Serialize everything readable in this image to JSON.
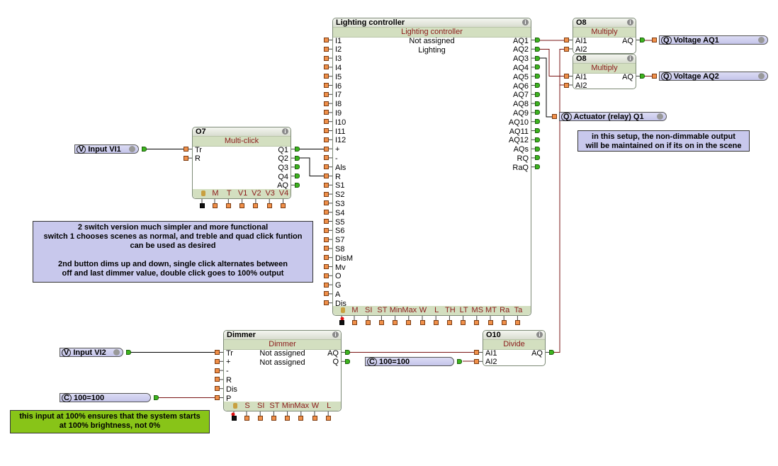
{
  "colors": {
    "analog_wire": "#7a1414",
    "digital_wire": "#000000",
    "note_blue": "#c8c8ec",
    "note_green": "#88c418"
  },
  "blocks": [
    {
      "id": "lighting",
      "title": "Lighting controller",
      "subtitle": "Lighting controller",
      "lines": [
        "Not assigned",
        "Lighting"
      ],
      "inputs": [
        "I1",
        "I2",
        "I3",
        "I4",
        "I5",
        "I6",
        "I7",
        "I8",
        "I9",
        "I10",
        "I11",
        "I12",
        "+",
        "-",
        "Als",
        "R",
        "S1",
        "S2",
        "S3",
        "S4",
        "S5",
        "S6",
        "S7",
        "S8",
        "DisM",
        "Mv",
        "O",
        "G",
        "A",
        "Dis"
      ],
      "outputs": [
        "AQ1",
        "AQ2",
        "AQ3",
        "AQ4",
        "AQ5",
        "AQ6",
        "AQ7",
        "AQ8",
        "AQ9",
        "AQ10",
        "AQ11",
        "AQ12",
        "AQs",
        "RQ",
        "RaQ"
      ],
      "params": [
        "M",
        "SI",
        "ST",
        "Min",
        "Max",
        "W",
        "L",
        "TH",
        "LT",
        "MS",
        "MT",
        "Ra",
        "Ta"
      ]
    },
    {
      "id": "multiclick",
      "title": "O7",
      "subtitle": "Multi-click",
      "lines": [],
      "inputs": [
        "Tr",
        "R"
      ],
      "outputs": [
        "Q1",
        "Q2",
        "Q3",
        "Q4",
        "AQ"
      ],
      "params": [
        "M",
        "T",
        "V1",
        "V2",
        "V3",
        "V4"
      ]
    },
    {
      "id": "multiply1",
      "title": "O8",
      "subtitle": "Multiply",
      "lines": [],
      "inputs": [
        "AI1",
        "AI2"
      ],
      "outputs": [
        "AQ"
      ],
      "params": []
    },
    {
      "id": "multiply2",
      "title": "O8",
      "subtitle": "Multiply",
      "lines": [],
      "inputs": [
        "AI1",
        "AI2"
      ],
      "outputs": [
        "AQ"
      ],
      "params": []
    },
    {
      "id": "dimmer",
      "title": "Dimmer",
      "subtitle": "Dimmer",
      "lines": [
        "Not assigned",
        "Not assigned"
      ],
      "inputs": [
        "Tr",
        "+",
        "-",
        "R",
        "Dis",
        "P"
      ],
      "outputs": [
        "AQ",
        "Q"
      ],
      "params": [
        "S",
        "SI",
        "ST",
        "Min",
        "Max",
        "W",
        "L"
      ]
    },
    {
      "id": "divide",
      "title": "O10",
      "subtitle": "Divide",
      "lines": [],
      "inputs": [
        "AI1",
        "AI2"
      ],
      "outputs": [
        "AQ"
      ],
      "params": []
    }
  ],
  "terminals": [
    {
      "tag": "Q",
      "label": "Voltage AQ1",
      "info": true
    },
    {
      "tag": "Q",
      "label": "Voltage AQ2",
      "info": true
    },
    {
      "tag": "Q",
      "label": "Actuator (relay) Q1",
      "info": true
    },
    {
      "tag": "V",
      "label": "Input VI1",
      "info": true
    },
    {
      "tag": "V",
      "label": "Input VI2",
      "info": true
    },
    {
      "tag": "C",
      "label": "100=100",
      "info": false
    },
    {
      "tag": "C",
      "label": "100=100",
      "info": false
    }
  ],
  "notes": [
    {
      "text": "in this setup, the non-dimmable output\nwill be maintained on if its on in the scene",
      "color": "#c8c8ec"
    },
    {
      "text": "2 switch version much simpler and more functional\nswitch 1 chooses scenes as normal, and treble and quad click funtion\ncan be used as desired\n\n2nd button dims up and down, single click alternates between\noff and last dimmer value, double click goes to 100% output",
      "color": "#c8c8ec"
    },
    {
      "text": "this input at 100% ensures that the system starts\nat 100% brightness, not 0%",
      "color": "#88c418"
    }
  ]
}
